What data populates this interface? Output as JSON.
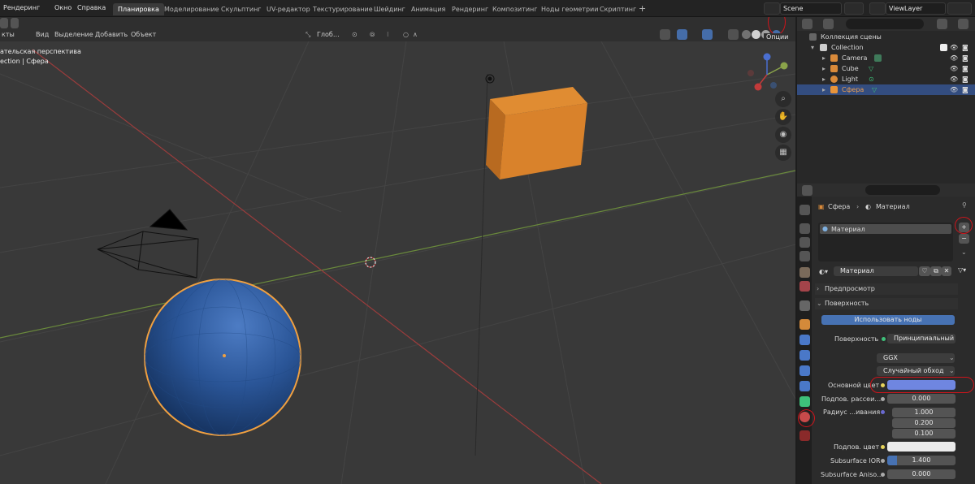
{
  "menubar": {
    "menus": [
      "Рендеринг",
      "Окно",
      "Справка"
    ],
    "workspaces": [
      "Планировка",
      "Моделирование",
      "Скульптинг",
      "UV-редактор",
      "Текстурирование",
      "Шейдинг",
      "Анимация",
      "Рендеринг",
      "Композитинг",
      "Ноды геометрии",
      "Скриптинг"
    ],
    "active_workspace": "Планировка",
    "scene": "Scene",
    "view_layer": "ViewLayer"
  },
  "viewport": {
    "header_menus": [
      "кты",
      "Вид",
      "Выделение",
      "Добавить",
      "Объект"
    ],
    "transform_orientation": "Глоб…",
    "options_label": "Опции",
    "view_name": "ательская перспектива",
    "collection_info": "ection | Сфера"
  },
  "outliner": {
    "scene_collection": "Коллекция сцены",
    "rows": [
      {
        "label": "Collection",
        "level": 1,
        "selected": false
      },
      {
        "label": "Camera",
        "level": 2,
        "selected": false
      },
      {
        "label": "Cube",
        "level": 2,
        "selected": false
      },
      {
        "label": "Light",
        "level": 2,
        "selected": false
      },
      {
        "label": "Сфера",
        "level": 2,
        "selected": true
      }
    ]
  },
  "properties": {
    "breadcrumb_object": "Сфера",
    "breadcrumb_material": "Материал",
    "slot_name": "Материал",
    "material_name": "Материал",
    "panel_preview": "Предпросмотр",
    "panel_surface": "Поверхность",
    "use_nodes": "Использовать ноды",
    "surface_label": "Поверхность",
    "surface_value": "Принципиальный BS…",
    "distribution": "GGX",
    "subsurface_method": "Случайный обход",
    "base_color_label": "Основной цвет",
    "base_color": "#6f86e0",
    "subsurface_label": "Подпов. рассеи…",
    "subsurface_value": "0.000",
    "radius_label": "Радиус …ивания",
    "radius_values": [
      "1.000",
      "0.200",
      "0.100"
    ],
    "subsurface_color_label": "Подпов. цвет",
    "subsurface_color": "#ebebeb",
    "subsurface_ior_label": "Subsurface IOR",
    "subsurface_ior_value": "1.400",
    "subsurface_aniso_label": "Subsurface Aniso…",
    "subsurface_aniso_value": "0.000"
  },
  "colors": {
    "accent": "#4772b3",
    "selection": "#334d80",
    "cube": "#d9822b",
    "sphere": "#2d5a9a",
    "highlight": "#d0141b"
  }
}
